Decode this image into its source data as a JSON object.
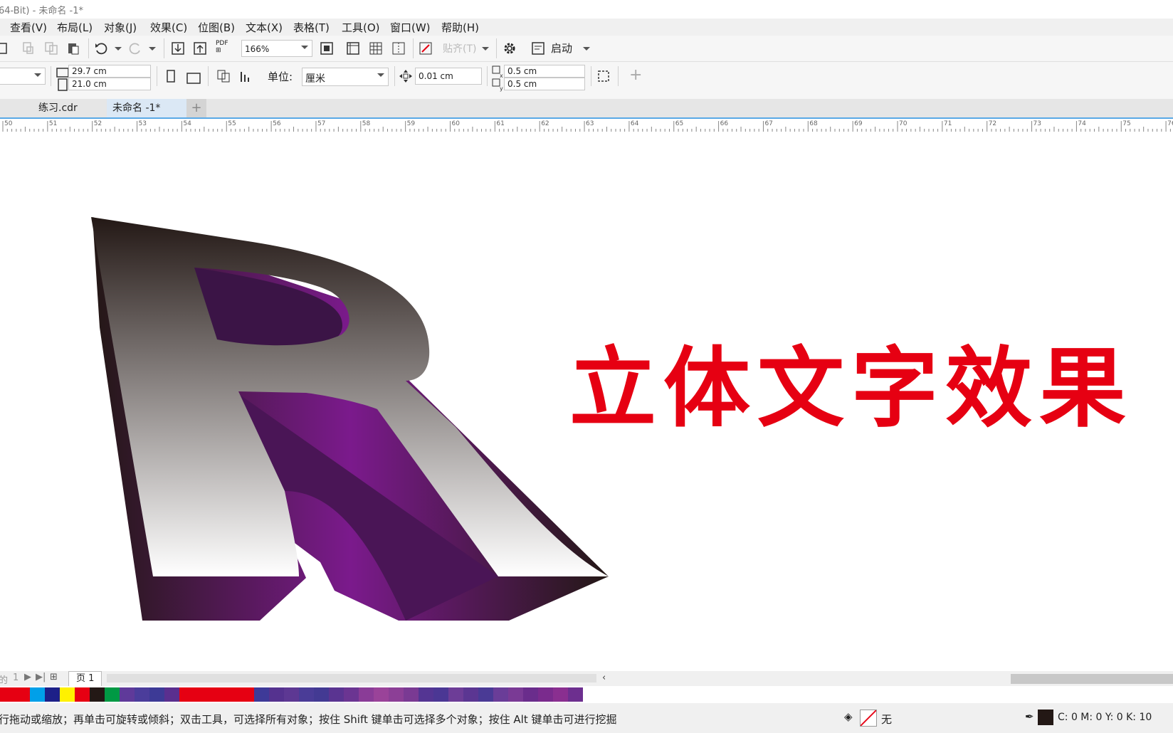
{
  "title": "64-Bit) - 未命名 -1*",
  "menu": [
    "查看(V)",
    "布局(L)",
    "对象(J)",
    "效果(C)",
    "位图(B)",
    "文本(X)",
    "表格(T)",
    "工具(O)",
    "窗口(W)",
    "帮助(H)"
  ],
  "toolbar": {
    "pdf_label": "PDF",
    "zoom": "166%",
    "paste_label": "贴齐(T)",
    "launch_label": "启动"
  },
  "propbar": {
    "page_height": "29.7 cm",
    "page_width": "21.0 cm",
    "unit_label": "单位:",
    "unit_value": "厘米",
    "nudge": "0.01 cm",
    "dup_x": "0.5 cm",
    "dup_y": "0.5 cm",
    "add_label": "+"
  },
  "tabs": [
    {
      "label": "练习.cdr",
      "active": false
    },
    {
      "label": "未命名 -1*",
      "active": true
    }
  ],
  "ruler_ticks": [
    "50",
    "51",
    "52",
    "53",
    "54",
    "55",
    "56",
    "57",
    "58",
    "59",
    "60",
    "61",
    "62",
    "63",
    "64",
    "65",
    "66",
    "67",
    "68",
    "69",
    "70",
    "71",
    "72",
    "73",
    "74",
    "75",
    "76"
  ],
  "canvas": {
    "heading": "立体文字效果",
    "heading_color": "#e60012",
    "letter_top": "#231815",
    "letter_bottom": "#ffffff",
    "extrude_color": "#7b1a8c"
  },
  "pagebar": {
    "prefix": "的",
    "page_number": "1",
    "page_tab": "页 1"
  },
  "palette": [
    "#e60012",
    "#e60012",
    "#00a0e9",
    "#1d2088",
    "#fff100",
    "#e60012",
    "#231815",
    "#009944",
    "#5f3a9a",
    "#4b3d9b",
    "#3d3a96",
    "#5a2f8f",
    "#e60012",
    "#e60012",
    "#e60012",
    "#e60012",
    "#e60012",
    "#3e3a98",
    "#55328f",
    "#5d3893",
    "#4a3c97",
    "#433a93",
    "#5a3491",
    "#6b3592",
    "#8a3c97",
    "#9a4399",
    "#8c3f96",
    "#7a3a93",
    "#543593",
    "#4b3794",
    "#6d3d97",
    "#5b3692",
    "#4a3a95",
    "#6a3d98",
    "#7a3a95",
    "#6a2d8c",
    "#7a2b8d",
    "#8a2f90",
    "#6d2f8f"
  ],
  "status": {
    "hint": "行拖动或缩放；再单击可旋转或倾斜；双击工具，可选择所有对象；按住 Shift 键单击可选择多个对象；按住 Alt 键单击可进行挖掘",
    "fill_label": "无",
    "cmyk": "C: 0 M: 0 Y: 0 K: 10"
  }
}
